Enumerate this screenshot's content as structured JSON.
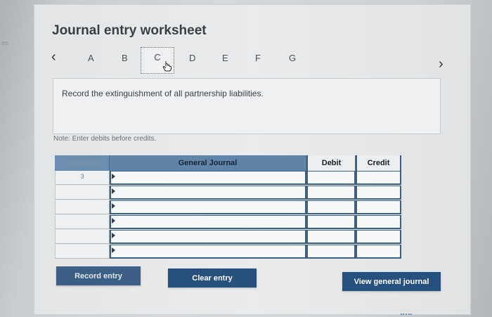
{
  "page": {
    "title": "Journal entry worksheet",
    "edge_text": "es"
  },
  "tabs": {
    "items": [
      "A",
      "B",
      "C",
      "D",
      "E",
      "F",
      "G"
    ],
    "active": "C",
    "prev_icon": "chevron-left-icon",
    "next_icon": "chevron-right-icon",
    "cursor_icon": "hand-pointer-icon"
  },
  "instruction": {
    "text": "Record the extinguishment of all partnership liabilities."
  },
  "note": {
    "text": "Note: Enter debits before credits."
  },
  "journal": {
    "headers": {
      "transaction": "Transaction",
      "general_journal": "General Journal",
      "debit": "Debit",
      "credit": "Credit"
    },
    "rows": [
      {
        "transaction": "3",
        "general_journal": "",
        "debit": "",
        "credit": ""
      },
      {
        "transaction": "",
        "general_journal": "",
        "debit": "",
        "credit": ""
      },
      {
        "transaction": "",
        "general_journal": "",
        "debit": "",
        "credit": ""
      },
      {
        "transaction": "",
        "general_journal": "",
        "debit": "",
        "credit": ""
      },
      {
        "transaction": "",
        "general_journal": "",
        "debit": "",
        "credit": ""
      },
      {
        "transaction": "",
        "general_journal": "",
        "debit": "",
        "credit": ""
      }
    ]
  },
  "buttons": {
    "record": "Record entry",
    "clear": "Clear entry",
    "view": "View general journal"
  },
  "colors": {
    "header_blue": "#5e84a8",
    "button_blue": "#26507e",
    "border_blue": "#3e5f80"
  }
}
